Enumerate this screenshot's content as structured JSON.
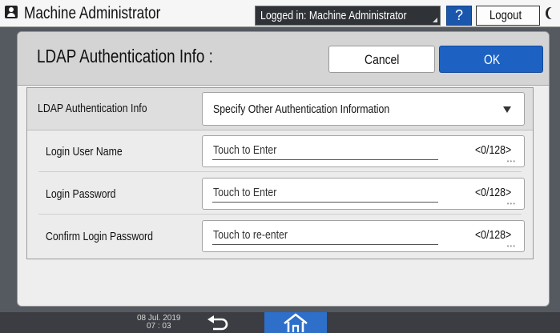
{
  "topbar": {
    "title": "Machine Administrator",
    "login_status": "Logged in: Machine Administrator",
    "help_label": "?",
    "logout_label": "Logout",
    "icons": [
      "user-icon",
      "moon-icon"
    ]
  },
  "dialog": {
    "title": "LDAP Authentication Info :",
    "cancel_label": "Cancel",
    "ok_label": "OK",
    "main_setting": {
      "label": "LDAP Authentication Info",
      "selected_value": "Specify Other Authentication Information"
    },
    "fields": [
      {
        "label": "Login User Name",
        "placeholder": "Touch to Enter",
        "counter": "<0/128>"
      },
      {
        "label": "Login Password",
        "placeholder": "Touch to Enter",
        "counter": "<0/128>"
      },
      {
        "label": "Confirm Login Password",
        "placeholder": "Touch to re-enter",
        "counter": "<0/128>"
      }
    ]
  },
  "bottombar": {
    "date": "08 Jul. 2019",
    "time": "07 : 03",
    "icons": [
      "back-icon",
      "home-icon"
    ]
  },
  "colors": {
    "accent_blue": "#1d61c3",
    "help_blue": "#1b56ad",
    "home_blue": "#2d6fc9",
    "background": "#555a61"
  }
}
